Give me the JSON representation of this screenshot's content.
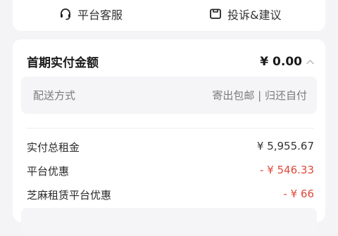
{
  "top_actions": {
    "service_label": "平台客服",
    "complaint_label": "投诉&建议"
  },
  "first_payment": {
    "title": "首期实付金额",
    "amount": "¥ 0.00"
  },
  "delivery": {
    "label": "配送方式",
    "value": "寄出包邮 | 归还自付"
  },
  "fees": [
    {
      "label": "实付总租金",
      "value": "¥ 5,955.67"
    },
    {
      "label": "平台优惠",
      "value": "- ¥ 546.33"
    },
    {
      "label": "芝麻租赁平台优惠",
      "value": "- ¥ 66"
    }
  ],
  "colors": {
    "discount": "#e0483a",
    "background": "#f4f4f6"
  }
}
